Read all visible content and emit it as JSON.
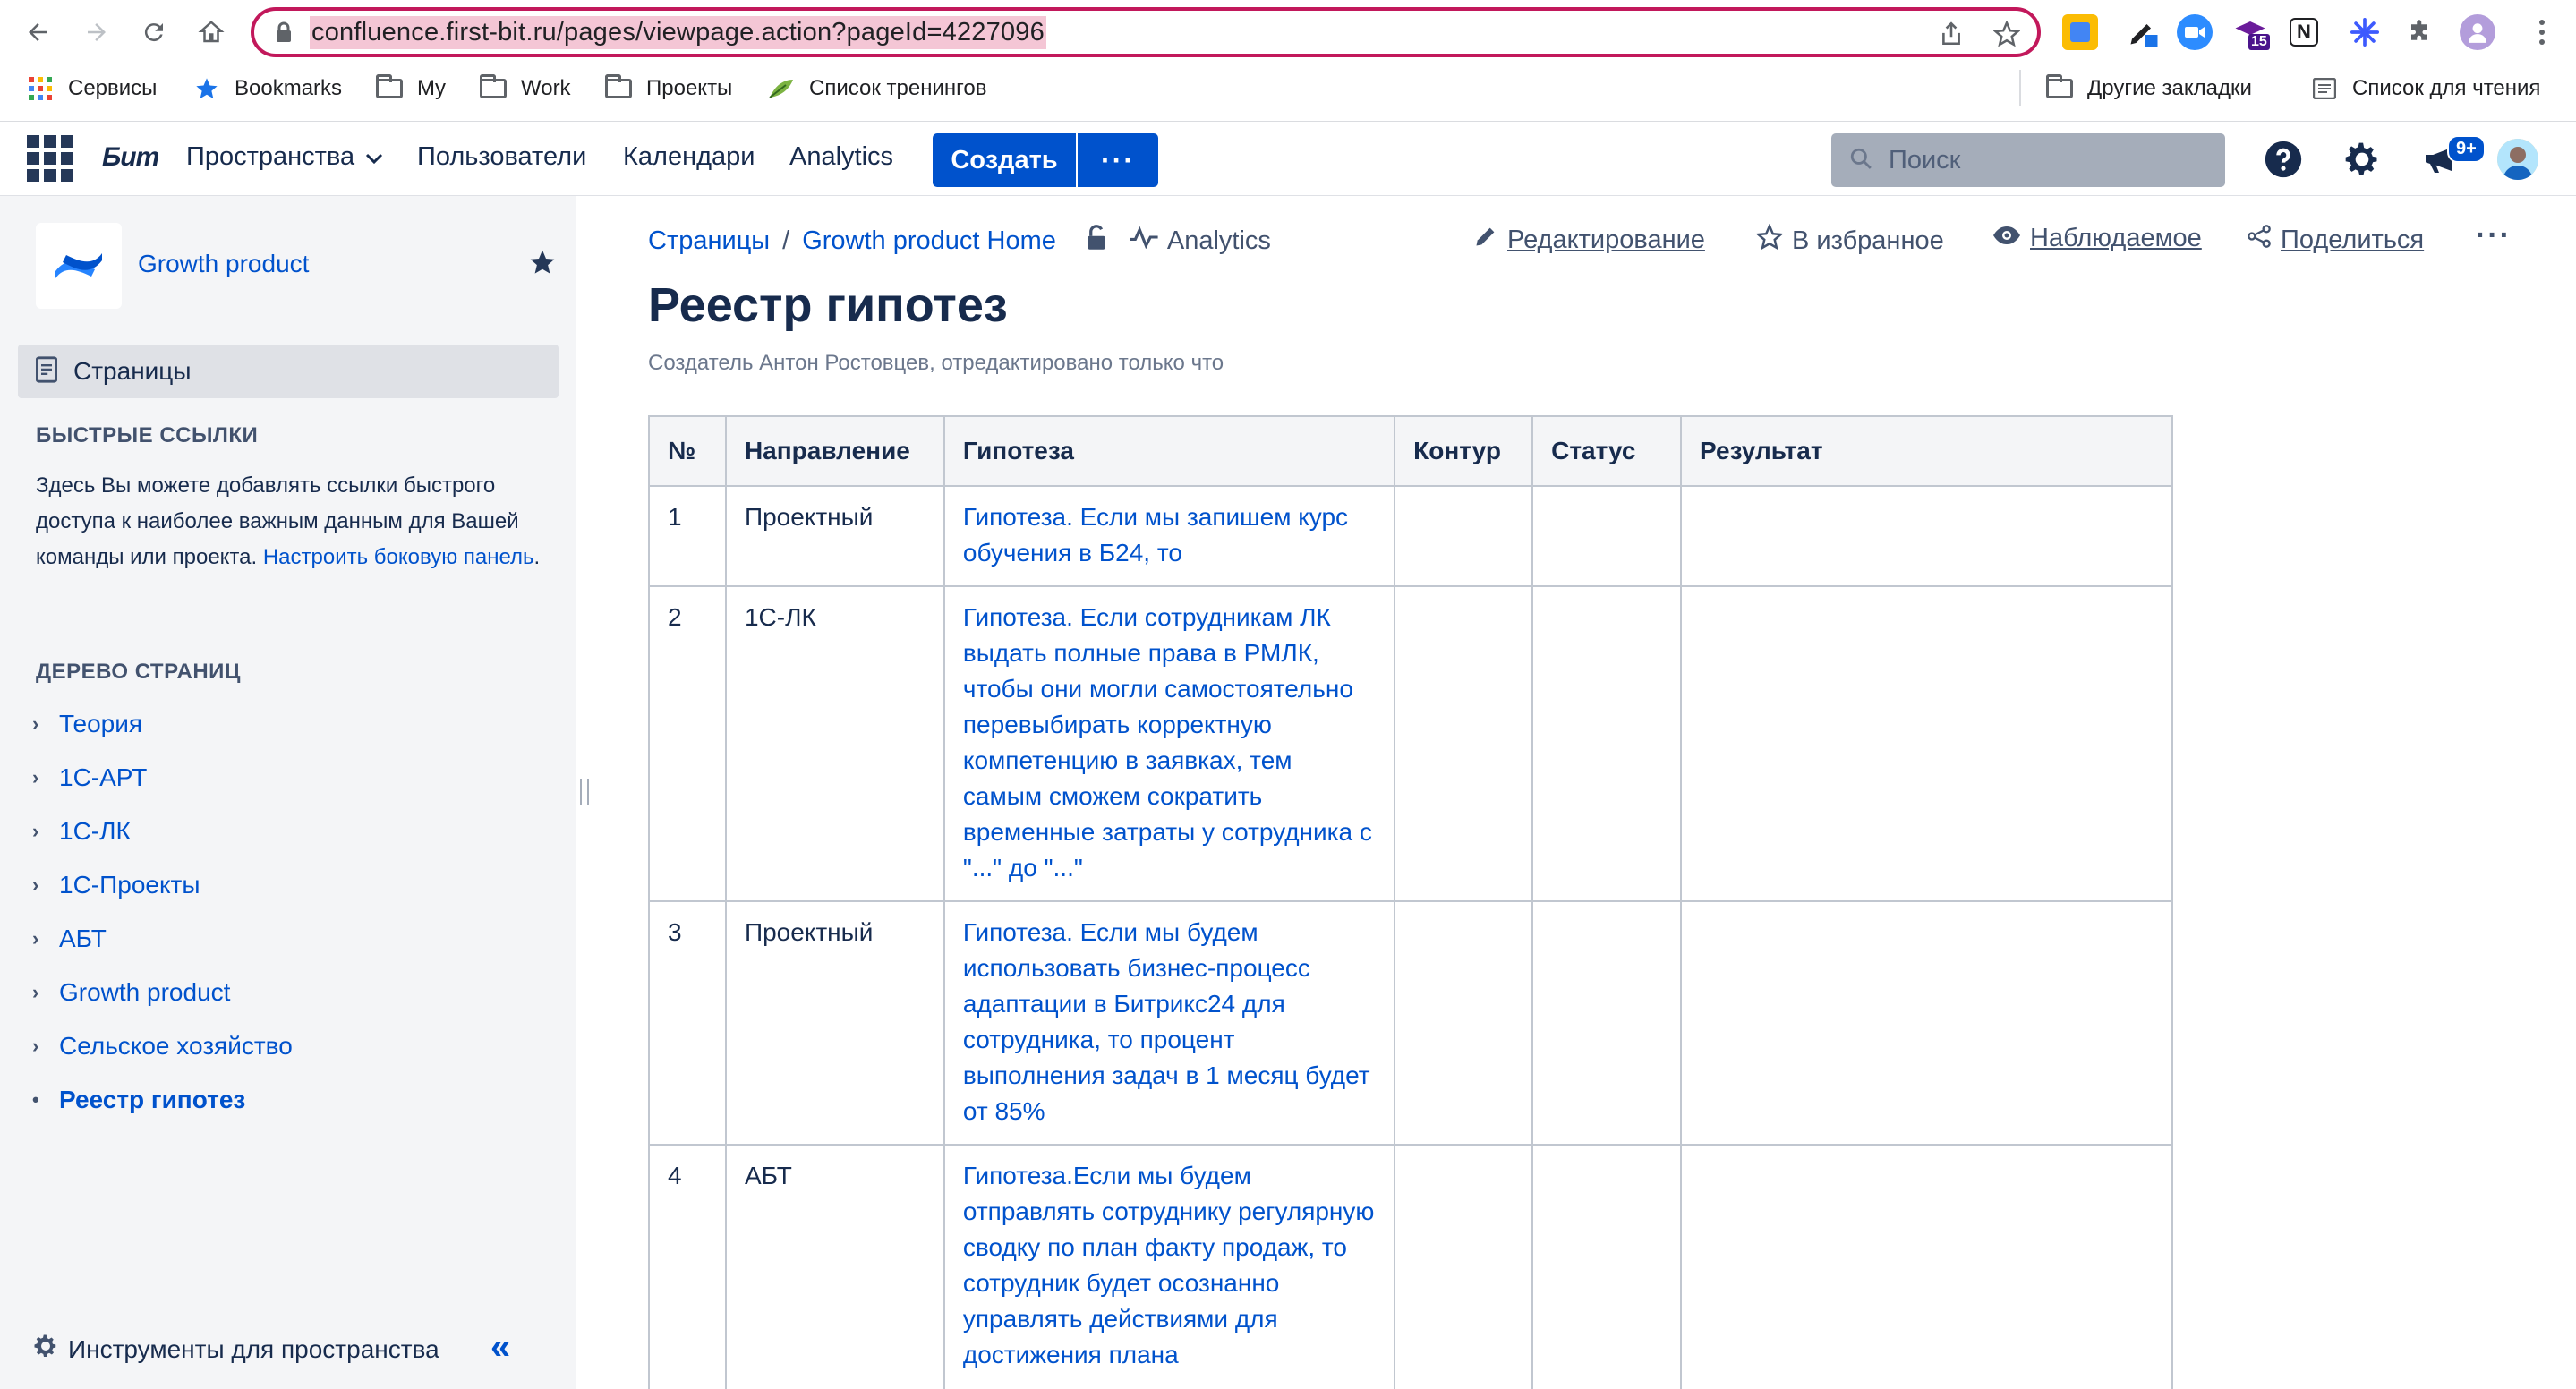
{
  "browser": {
    "url": "confluence.first-bit.ru/pages/viewpage.action?pageId=4227096",
    "ext_badge": "15",
    "bookmarks": [
      {
        "label": "Сервисы"
      },
      {
        "label": "Bookmarks"
      },
      {
        "label": "My"
      },
      {
        "label": "Work"
      },
      {
        "label": "Проекты"
      },
      {
        "label": "Список тренингов"
      }
    ],
    "other_bookmarks": "Другие закладки",
    "reading_list": "Список для чтения"
  },
  "header": {
    "logo": "Бит",
    "nav": [
      "Пространства",
      "Пользователи",
      "Календари",
      "Analytics"
    ],
    "create_label": "Создать",
    "more_label": "···",
    "search_placeholder": "Поиск",
    "notification_badge": "9+"
  },
  "sidebar": {
    "space_name": "Growth product",
    "pages_label": "Страницы",
    "quick_links_title": "БЫСТРЫЕ ССЫЛКИ",
    "quick_links_text": "Здесь Вы можете добавлять ссылки быстрого доступа к наиболее важным данным для Вашей команды или проекта. ",
    "quick_links_link": "Настроить боковую панель",
    "quick_links_end": ".",
    "tree_title": "ДЕРЕВО СТРАНИЦ",
    "tree": [
      {
        "label": "Теория"
      },
      {
        "label": "1С-АРТ"
      },
      {
        "label": "1С-ЛК"
      },
      {
        "label": "1С-Проекты"
      },
      {
        "label": "АБТ"
      },
      {
        "label": "Growth product"
      },
      {
        "label": "Сельское хозяйство"
      },
      {
        "label": "Реестр гипотез"
      }
    ],
    "tools_label": "Инструменты для пространства"
  },
  "page": {
    "breadcrumb": [
      "Страницы",
      "Growth product Home"
    ],
    "analytics_label": "Analytics",
    "actions": {
      "edit": "Редактирование",
      "favorite": "В избранное",
      "watch": "Наблюдаемое",
      "share": "Поделиться"
    },
    "title": "Реестр гипотез",
    "byline": "Создатель Антон Ростовцев, отредактировано только что"
  },
  "table": {
    "headers": [
      "№",
      "Направление",
      "Гипотеза",
      "Контур",
      "Статус",
      "Результат"
    ],
    "rows": [
      {
        "n": "1",
        "direction": "Проектный",
        "hypothesis": "Гипотеза. Если мы запишем курс обучения в Б24, то",
        "contour": "",
        "status": "",
        "result": ""
      },
      {
        "n": "2",
        "direction": "1С-ЛК",
        "hypothesis": "Гипотеза. Если сотрудникам ЛК выдать полные права в РМЛК, чтобы они могли самостоятельно перевыбирать корректную компетенцию в заявках, тем самым сможем сократить временные затраты у сотрудника с \"...\" до \"...\"",
        "contour": "",
        "status": "",
        "result": ""
      },
      {
        "n": "3",
        "direction": "Проектный",
        "hypothesis": "Гипотеза. Если мы будем использовать бизнес-процесс адаптации в Битрикс24 для сотрудника, то процент выполнения задач в 1 месяц будет от 85%",
        "contour": "",
        "status": "",
        "result": ""
      },
      {
        "n": "4",
        "direction": "АБТ",
        "hypothesis": "Гипотеза.Если мы будем отправлять сотруднику регулярную сводку по план факту продаж, то сотрудник будет осознанно управлять действиями для достижения плана",
        "contour": "",
        "status": "",
        "result": ""
      }
    ]
  }
}
